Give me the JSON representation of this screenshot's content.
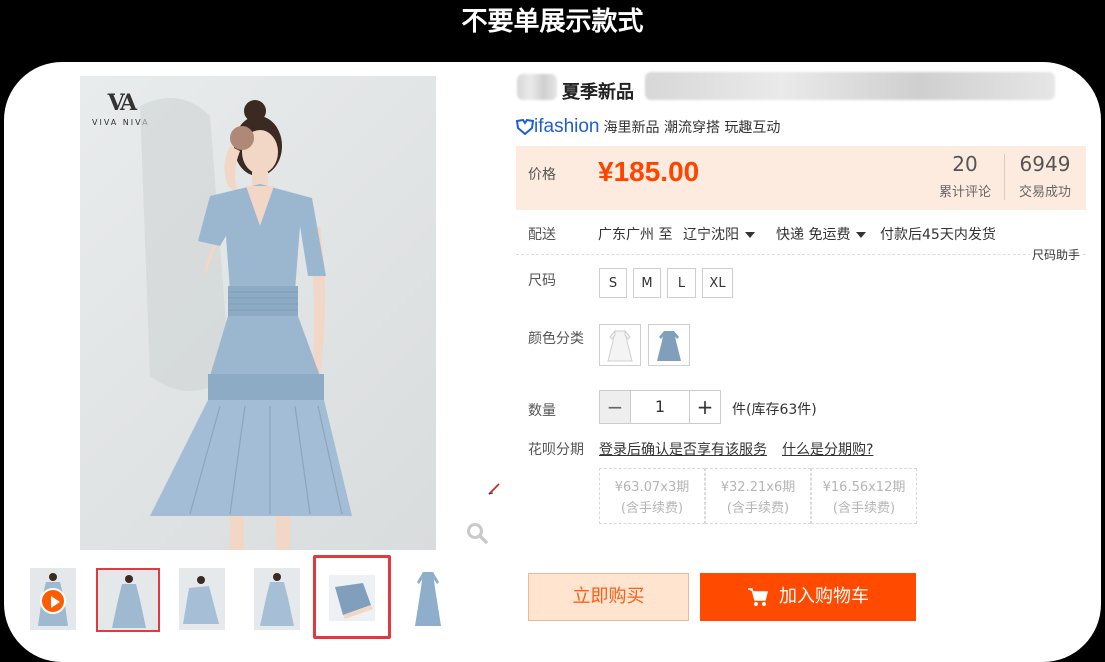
{
  "banner": {
    "title": "不要单展示款式"
  },
  "brand": {
    "mark": "VA",
    "name": "VIVA NIVA"
  },
  "product": {
    "title_fragment": "夏季新品",
    "ifashion_logo": "ifashion",
    "ifashion_tagline": "海里新品 潮流穿搭 玩趣互动"
  },
  "price": {
    "label": "价格",
    "value": "¥185.00",
    "reviews_count": "20",
    "reviews_label": "累计评论",
    "deals_count": "6949",
    "deals_label": "交易成功"
  },
  "delivery": {
    "label": "配送",
    "from": "广东广州 至",
    "to": "辽宁沈阳",
    "method": "快递 免运费",
    "ship_note": "付款后45天内发货",
    "size_helper": "尺码助手"
  },
  "size": {
    "label": "尺码",
    "options": [
      "S",
      "M",
      "L",
      "XL"
    ]
  },
  "color": {
    "label": "颜色分类",
    "options": [
      "white-dress-icon",
      "blue-dress-icon"
    ]
  },
  "quantity": {
    "label": "数量",
    "minus": "−",
    "value": "1",
    "plus": "+",
    "stock": "件(库存63件)"
  },
  "installment": {
    "label": "花呗分期",
    "login_link": "登录后确认是否享有该服务",
    "what_link": "什么是分期购?",
    "plans": [
      {
        "amount": "¥63.07x3期",
        "fee": "(含手续费)"
      },
      {
        "amount": "¥32.21x6期",
        "fee": "(含手续费)"
      },
      {
        "amount": "¥16.56x12期",
        "fee": "(含手续费)"
      }
    ]
  },
  "actions": {
    "buy_now": "立即购买",
    "add_cart": "加入购物车"
  },
  "colors": {
    "accent": "#ff4400",
    "price_bg": "#fdebdf",
    "ifashion_blue": "#1f5fd1",
    "highlight_red": "#e4393c"
  }
}
